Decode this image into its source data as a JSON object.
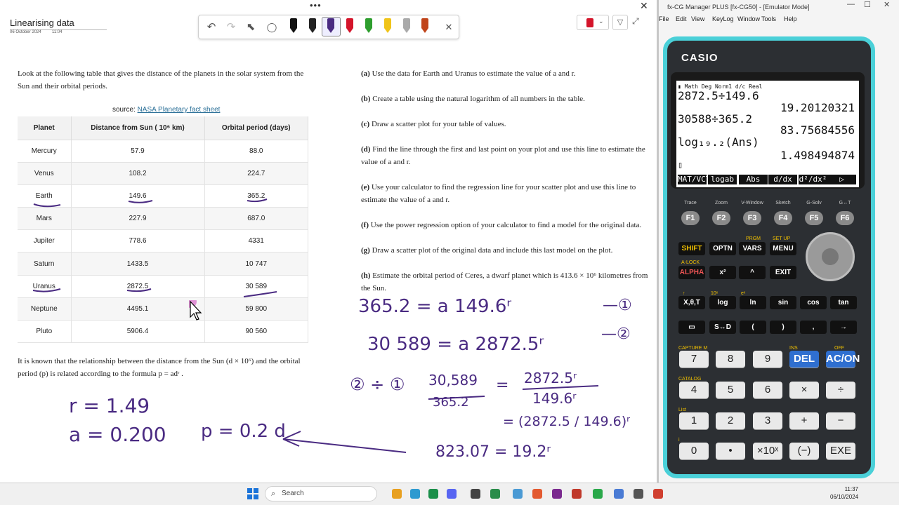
{
  "onenote": {
    "title": "Linearising data",
    "date": "06 October 2024",
    "time": "11:04",
    "menu_dots": "•••",
    "close": "✕"
  },
  "toolbar": {
    "undo": "↶",
    "redo": "↷",
    "select": "⬉",
    "lasso": "◯",
    "close": "✕",
    "pens": [
      "#111111",
      "#222222",
      "#4a2b82",
      "#d4142a",
      "#2e9e2e",
      "#f0c419",
      "#aaaaaa",
      "#c0441a"
    ]
  },
  "intro": "Look at the following table that gives the distance of the planets in the solar system from the Sun and their orbital periods.",
  "source": {
    "prefix": "source: ",
    "link": "NASA Planetary fact sheet"
  },
  "table": {
    "headers": [
      "Planet",
      "Distance from Sun ( 10⁶ km)",
      "Orbital period (days)"
    ],
    "rows": [
      [
        "Mercury",
        "57.9",
        "88.0"
      ],
      [
        "Venus",
        "108.2",
        "224.7"
      ],
      [
        "Earth",
        "149.6",
        "365.2"
      ],
      [
        "Mars",
        "227.9",
        "687.0"
      ],
      [
        "Jupiter",
        "778.6",
        "4331"
      ],
      [
        "Saturn",
        "1433.5",
        "10 747"
      ],
      [
        "Uranus",
        "2872.5",
        "30 589"
      ],
      [
        "Neptune",
        "4495.1",
        "59 800"
      ],
      [
        "Pluto",
        "5906.4",
        "90 560"
      ]
    ]
  },
  "relationship": "It is known that the relationship between the distance from the Sun (d × 10⁶) and the orbital period (p) is related according to the formula  p = adʳ .",
  "questions": [
    {
      "label": "(a)",
      "text": " Use the data for Earth and Uranus to estimate the value of a and r."
    },
    {
      "label": "(b)",
      "text": " Create a table using the natural logarithm of all numbers in the table."
    },
    {
      "label": "(c)",
      "text": " Draw a scatter plot for your table of values."
    },
    {
      "label": "(d)",
      "text": " Find the line through the first and last point on your plot and use this line to estimate the value of a and r."
    },
    {
      "label": "(e)",
      "text": " Use your calculator to find the regression line for your scatter plot and use this line to estimate the value of a and r."
    },
    {
      "label": "(f)",
      "text": " Use the power regression option of your calculator to find a model for the original data."
    },
    {
      "label": "(g)",
      "text": " Draw a scatter plot of the original data and include this last model on the plot."
    },
    {
      "label": "(h)",
      "text": " Estimate the orbital period of Ceres, a dwarf planet which is  413.6 × 10⁶  kilometres from the Sun."
    }
  ],
  "handwriting": {
    "eq1": "365.2 = a 149.6ʳ",
    "mark1": "—①",
    "eq2": "30 589 = a 2872.5ʳ",
    "mark2": "—②",
    "divide": "② ÷ ①",
    "frac_num": "30,589",
    "frac_den": "365.2",
    "eq_sign": "=",
    "rfrac_num": "2872.5ʳ",
    "rfrac_den": "149.6ʳ",
    "paren": "= (2872.5 / 149.6)ʳ",
    "result": "823.07 = 19.2ʳ",
    "r_val": "r = 1.49",
    "a_val": "a = 0.200",
    "p_model": "p = 0.2 d"
  },
  "emulator": {
    "title": "fx-CG Manager PLUS [fx-CG50] - [Emulator Mode]",
    "win_controls": [
      "—",
      "☐",
      "✕"
    ],
    "menu": [
      "File",
      "Edit",
      "View",
      "KeyLog",
      "Window",
      "Tools",
      "Help"
    ],
    "brand": "CASIO",
    "status": "▮ Math Deg Norm1 d/c Real",
    "screen": [
      "2872.5÷149.6",
      "19.20120321",
      "30588÷365.2",
      "83.75684556",
      "log₁₉.₂(Ans)",
      "1.498494874",
      "▯"
    ],
    "softkeys": [
      "MAT/VCT",
      "logab",
      "Abs",
      "d/dx",
      "d²/dx²",
      "▷"
    ],
    "fkey_labels": [
      "Trace",
      "Zoom",
      "V-Window",
      "Sketch",
      "G-Solv",
      "G↔T"
    ],
    "fkeys": [
      "F1",
      "F2",
      "F3",
      "F4",
      "F5",
      "F6"
    ],
    "row1": [
      "SHIFT",
      "OPTN",
      "VARS",
      "MENU"
    ],
    "row2": [
      "ALPHA",
      "x²",
      "^",
      "EXIT"
    ],
    "row3": [
      "X,θ,T",
      "log",
      "ln",
      "sin",
      "cos",
      "tan"
    ],
    "row4": [
      "▭",
      "S↔D",
      "(",
      ")",
      ",",
      "→"
    ],
    "num1": [
      "7",
      "8",
      "9",
      "DEL",
      "AC/ON"
    ],
    "num2": [
      "4",
      "5",
      "6",
      "×",
      "÷"
    ],
    "num3": [
      "1",
      "2",
      "3",
      "+",
      "−"
    ],
    "num4": [
      "0",
      "•",
      "×10ˣ",
      "(−)",
      "EXE"
    ]
  },
  "taskbar": {
    "search": "Search",
    "time": "11:37",
    "date": "06/10/2024"
  }
}
